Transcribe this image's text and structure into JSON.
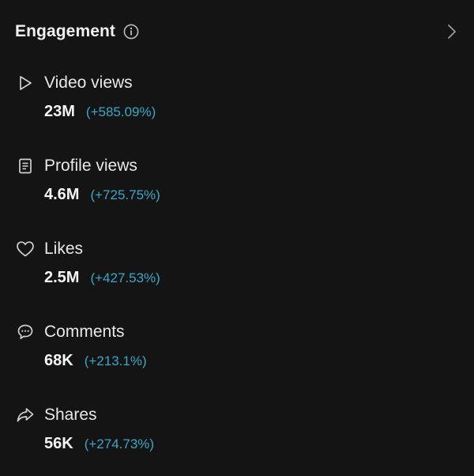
{
  "header": {
    "title": "Engagement"
  },
  "metrics": [
    {
      "icon": "play-icon",
      "label": "Video views",
      "value": "23M",
      "change": "(+585.09%)"
    },
    {
      "icon": "profile-document-icon",
      "label": "Profile views",
      "value": "4.6M",
      "change": "(+725.75%)"
    },
    {
      "icon": "heart-icon",
      "label": "Likes",
      "value": "2.5M",
      "change": "(+427.53%)"
    },
    {
      "icon": "comment-icon",
      "label": "Comments",
      "value": "68K",
      "change": "(+213.1%)"
    },
    {
      "icon": "share-icon",
      "label": "Shares",
      "value": "56K",
      "change": "(+274.73%)"
    }
  ],
  "colors": {
    "background": "#141414",
    "text": "#e8e8e8",
    "change_positive": "#3aa7c7"
  }
}
